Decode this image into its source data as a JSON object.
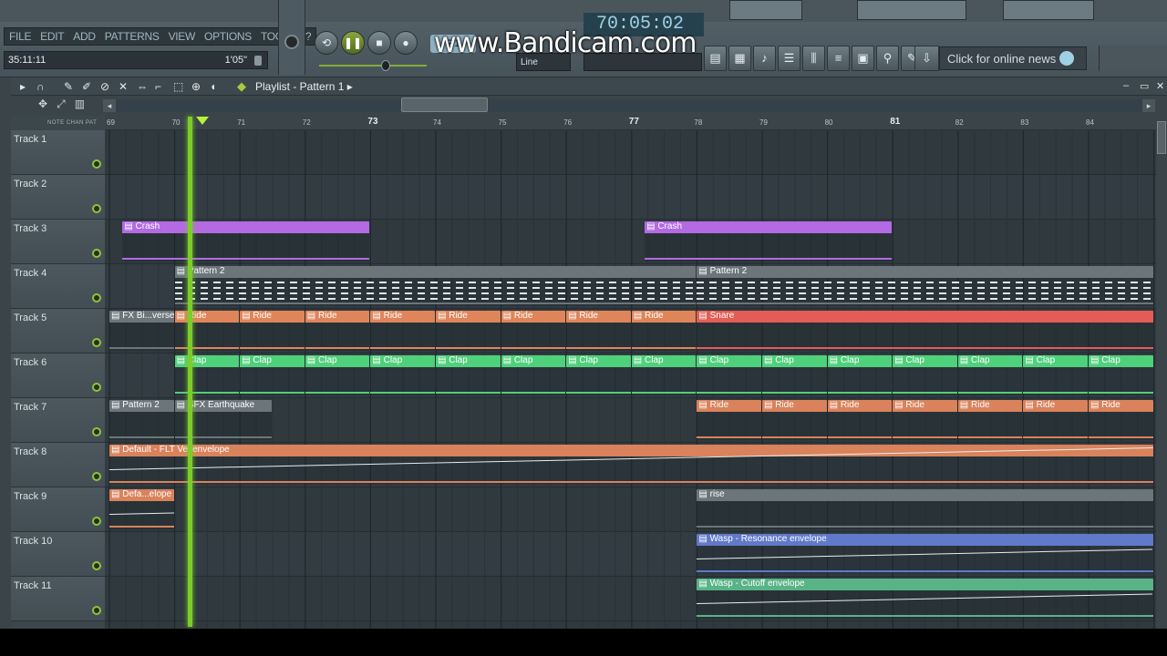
{
  "menu": [
    "FILE",
    "EDIT",
    "ADD",
    "PATTERNS",
    "VIEW",
    "OPTIONS",
    "TOOLS",
    "?"
  ],
  "hint": {
    "left": "35:11:11",
    "right": "1'05\""
  },
  "time_display": "70:05:02",
  "pattern_selector": "P.1",
  "snap_label": "Line",
  "watermark": "www.Bandicam.com",
  "news": "Click for online news",
  "playlist_title": "Playlist - Pattern 1",
  "tool_labels": "NOTE  CHAN  PAT",
  "ruler": [
    {
      "t": "69",
      "big": false
    },
    {
      "t": "70",
      "big": false
    },
    {
      "t": "71",
      "big": false
    },
    {
      "t": "72",
      "big": false
    },
    {
      "t": "73",
      "big": true
    },
    {
      "t": "74",
      "big": false
    },
    {
      "t": "75",
      "big": false
    },
    {
      "t": "76",
      "big": false
    },
    {
      "t": "77",
      "big": true
    },
    {
      "t": "78",
      "big": false
    },
    {
      "t": "79",
      "big": false
    },
    {
      "t": "80",
      "big": false
    },
    {
      "t": "81",
      "big": true
    },
    {
      "t": "82",
      "big": false
    },
    {
      "t": "83",
      "big": false
    },
    {
      "t": "84",
      "big": false
    }
  ],
  "tracks": [
    "Track 1",
    "Track 2",
    "Track 3",
    "Track 4",
    "Track 5",
    "Track 6",
    "Track 7",
    "Track 8",
    "Track 9",
    "Track 10",
    "Track 11"
  ],
  "colors": {
    "purple": "#b36ae2",
    "gray": "#6b757a",
    "orange": "#e0855a",
    "green": "#4fd07a",
    "salmon": "#d9825b",
    "red": "#e35d56",
    "blue": "#6179c9",
    "teal": "#58b386",
    "playhead": "#7ccc2a"
  },
  "clips": [
    {
      "track": 2,
      "start": 69.2,
      "end": 73,
      "label": "Crash",
      "color": "purple"
    },
    {
      "track": 2,
      "start": 77.2,
      "end": 81,
      "label": "Crash",
      "color": "purple"
    },
    {
      "track": 3,
      "start": 70,
      "end": 78,
      "label": "Pattern 2",
      "color": "gray"
    },
    {
      "track": 3,
      "start": 78,
      "end": 85,
      "label": "Pattern 2",
      "color": "gray"
    },
    {
      "track": 4,
      "start": 69,
      "end": 70,
      "label": "FX Bi...verse",
      "color": "gray"
    },
    {
      "track": 4,
      "start": 70,
      "end": 71,
      "label": "Ride",
      "color": "orange"
    },
    {
      "track": 4,
      "start": 71,
      "end": 72,
      "label": "Ride",
      "color": "orange"
    },
    {
      "track": 4,
      "start": 72,
      "end": 73,
      "label": "Ride",
      "color": "orange"
    },
    {
      "track": 4,
      "start": 73,
      "end": 74,
      "label": "Ride",
      "color": "orange"
    },
    {
      "track": 4,
      "start": 74,
      "end": 75,
      "label": "Ride",
      "color": "orange"
    },
    {
      "track": 4,
      "start": 75,
      "end": 76,
      "label": "Ride",
      "color": "orange"
    },
    {
      "track": 4,
      "start": 76,
      "end": 77,
      "label": "Ride",
      "color": "orange"
    },
    {
      "track": 4,
      "start": 77,
      "end": 78,
      "label": "Ride",
      "color": "orange"
    },
    {
      "track": 4,
      "start": 78,
      "end": 85,
      "label": "Snare",
      "color": "red"
    },
    {
      "track": 5,
      "start": 70,
      "end": 71,
      "label": "Clap",
      "color": "green"
    },
    {
      "track": 5,
      "start": 71,
      "end": 72,
      "label": "Clap",
      "color": "green"
    },
    {
      "track": 5,
      "start": 72,
      "end": 73,
      "label": "Clap",
      "color": "green"
    },
    {
      "track": 5,
      "start": 73,
      "end": 74,
      "label": "Clap",
      "color": "green"
    },
    {
      "track": 5,
      "start": 74,
      "end": 75,
      "label": "Clap",
      "color": "green"
    },
    {
      "track": 5,
      "start": 75,
      "end": 76,
      "label": "Clap",
      "color": "green"
    },
    {
      "track": 5,
      "start": 76,
      "end": 77,
      "label": "Clap",
      "color": "green"
    },
    {
      "track": 5,
      "start": 77,
      "end": 78,
      "label": "Clap",
      "color": "green"
    },
    {
      "track": 5,
      "start": 78,
      "end": 79,
      "label": "Clap",
      "color": "green"
    },
    {
      "track": 5,
      "start": 79,
      "end": 80,
      "label": "Clap",
      "color": "green"
    },
    {
      "track": 5,
      "start": 80,
      "end": 81,
      "label": "Clap",
      "color": "green"
    },
    {
      "track": 5,
      "start": 81,
      "end": 82,
      "label": "Clap",
      "color": "green"
    },
    {
      "track": 5,
      "start": 82,
      "end": 83,
      "label": "Clap",
      "color": "green"
    },
    {
      "track": 5,
      "start": 83,
      "end": 84,
      "label": "Clap",
      "color": "green"
    },
    {
      "track": 5,
      "start": 84,
      "end": 85,
      "label": "Clap",
      "color": "green"
    },
    {
      "track": 6,
      "start": 69,
      "end": 70,
      "label": "Pattern 2",
      "color": "gray"
    },
    {
      "track": 6,
      "start": 70,
      "end": 71.5,
      "label": "SFX Earthquake",
      "color": "gray"
    },
    {
      "track": 6,
      "start": 78,
      "end": 79,
      "label": "Ride",
      "color": "salmon"
    },
    {
      "track": 6,
      "start": 79,
      "end": 80,
      "label": "Ride",
      "color": "salmon"
    },
    {
      "track": 6,
      "start": 80,
      "end": 81,
      "label": "Ride",
      "color": "salmon"
    },
    {
      "track": 6,
      "start": 81,
      "end": 82,
      "label": "Ride",
      "color": "salmon"
    },
    {
      "track": 6,
      "start": 82,
      "end": 83,
      "label": "Ride",
      "color": "salmon"
    },
    {
      "track": 6,
      "start": 83,
      "end": 84,
      "label": "Ride",
      "color": "salmon"
    },
    {
      "track": 6,
      "start": 84,
      "end": 85,
      "label": "Ride",
      "color": "salmon"
    },
    {
      "track": 7,
      "start": 69,
      "end": 85,
      "label": "Default - FLT Vel envelope",
      "color": "salmon"
    },
    {
      "track": 8,
      "start": 69,
      "end": 70,
      "label": "Defa...elope",
      "color": "salmon"
    },
    {
      "track": 8,
      "start": 78,
      "end": 85,
      "label": "rise",
      "color": "gray"
    },
    {
      "track": 9,
      "start": 78,
      "end": 85,
      "label": "Wasp - Resonance envelope",
      "color": "blue"
    },
    {
      "track": 10,
      "start": 78,
      "end": 85,
      "label": "Wasp - Cutoff envelope",
      "color": "teal"
    }
  ]
}
